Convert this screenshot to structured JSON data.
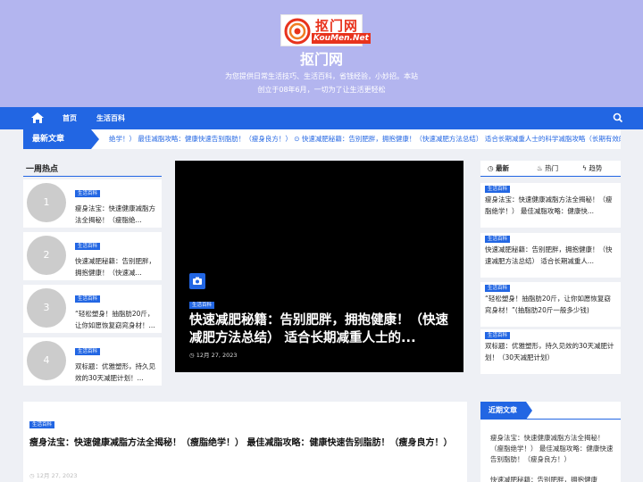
{
  "header": {
    "logo_text": "抠门网",
    "logo_domain": "KouMen.Net",
    "site_title": "抠门网",
    "tagline": "为您提供日常生活技巧、生活百科，省钱经验，小妙招。本站创立于08年6月，一切为了让生活更轻松"
  },
  "nav": {
    "home_icon": "home-icon",
    "items": [
      "首页",
      "生活百科"
    ],
    "search_icon": "search-icon"
  },
  "ticker": {
    "label": "最新文章",
    "text": "绝学！）   最佳减脂攻略：健康快速告别脂肪！（瘦身良方！）    ⊙ 快速减肥秘籍：告别肥胖，拥抱健康！（快速减肥方法总结） 适合长期减重人士的科学减脂攻略（长期有效的减肥方"
  },
  "hot": {
    "title": "一周热点",
    "items": [
      {
        "num": "1",
        "tag": "生活百科",
        "text": "瘦身法宝：快速健康减脂方法全揭秘！（瘦脂绝..."
      },
      {
        "num": "2",
        "tag": "生活百科",
        "text": "快速减肥秘籍：告别肥胖，拥抱健康！（快速减..."
      },
      {
        "num": "3",
        "tag": "生活百科",
        "text": "“轻松塑身！抽脂肪20斤，让你如愿恢复窈窕身材！..."
      },
      {
        "num": "4",
        "tag": "生活百科",
        "text": "双标题：优雅塑形，持久见效的30天减肥计划！..."
      }
    ]
  },
  "featured": {
    "tag": "生活百科",
    "title": "快速减肥秘籍：告别肥胖，拥抱健康！（快速减肥方法总结） 适合长期减重人士的...",
    "date": "12月 27, 2023",
    "camera_icon": "camera-icon"
  },
  "tabs": {
    "items": [
      {
        "label": "最新",
        "icon": "clock-icon"
      },
      {
        "label": "热门",
        "icon": "flame-icon"
      },
      {
        "label": "趋势",
        "icon": "bolt-icon"
      }
    ],
    "cards": [
      {
        "tag": "生活百科",
        "text": "瘦身法宝：快速健康减脂方法全揭秘！（瘦脂绝学！） 最佳减脂攻略：健康快..."
      },
      {
        "tag": "生活百科",
        "text": "快速减肥秘籍：告别肥胖，拥抱健康！（快速减肥方法总结） 适合长期减重人..."
      },
      {
        "tag": "生活百科",
        "text": "“轻松塑身！抽脂肪20斤，让你如愿恢复窈窕身材！”(抽脂肪20斤一般多少钱)"
      },
      {
        "tag": "生活百科",
        "text": "双标题：优雅塑形，持久见效的30天减肥计划！（30天减肥计划）"
      }
    ]
  },
  "post": {
    "tag": "生活百科",
    "title": "瘦身法宝：快速健康减脂方法全揭秘！（瘦脂绝学！） 最佳减脂攻略：健康快速告别脂肪！（瘦身良方！）",
    "date": "12月 27, 2023"
  },
  "recent": {
    "label": "近期文章",
    "items": [
      "瘦身法宝：快速健康减脂方法全揭秘！（瘦脂绝学！） 最佳减脂攻略：健康快速告别脂肪！（瘦身良方！）",
      "快速减肥秘籍：告别肥胖，拥抱健康"
    ]
  },
  "colors": {
    "header_bg": "#b3b5ef",
    "accent": "#2266e3",
    "page_bg": "#eef0f5",
    "featured_bg": "#000000"
  }
}
